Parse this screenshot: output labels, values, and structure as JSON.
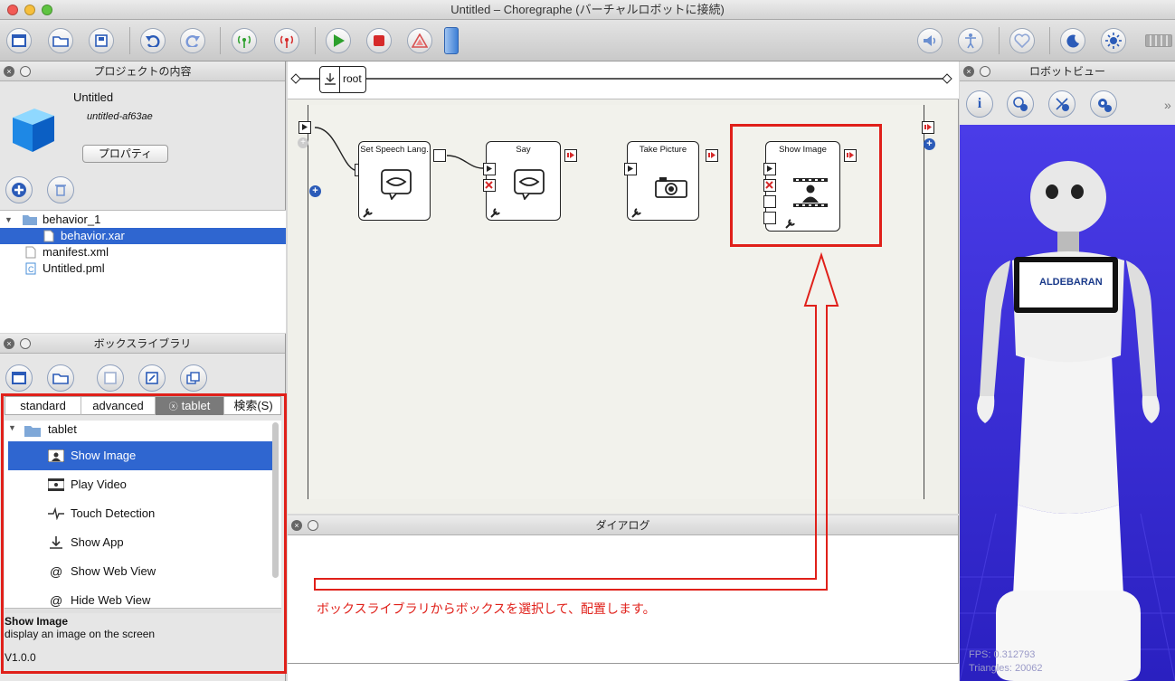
{
  "window": {
    "title": "Untitled – Choregraphe (バーチャルロボットに接続)"
  },
  "colors": {
    "accent": "#2f66d0",
    "annotation": "#e0201a",
    "robot_bg": "#3a2cd8"
  },
  "project_panel": {
    "title": "プロジェクトの内容",
    "project_name": "Untitled",
    "project_id": "untitled-af63ae",
    "properties_button": "プロパティ",
    "tree": [
      {
        "label": "behavior_1"
      },
      {
        "label": "behavior.xar"
      },
      {
        "label": "manifest.xml"
      },
      {
        "label": "Untitled.pml"
      }
    ]
  },
  "library_panel": {
    "title": "ボックスライブラリ",
    "tabs": [
      {
        "label": "standard"
      },
      {
        "label": "advanced"
      },
      {
        "label": "tablet"
      },
      {
        "label": "検索(S)"
      }
    ],
    "folder": "tablet",
    "items": [
      {
        "label": "Show Image",
        "icon": "film-person-icon"
      },
      {
        "label": "Play Video",
        "icon": "film-icon"
      },
      {
        "label": "Touch Detection",
        "icon": "pulse-icon"
      },
      {
        "label": "Show App",
        "icon": "download-icon"
      },
      {
        "label": "Show Web View",
        "icon": "at-icon"
      },
      {
        "label": "Hide Web View",
        "icon": "at-icon"
      }
    ],
    "detail": {
      "name": "Show Image",
      "description": "display an image on the screen",
      "version": "V1.0.0"
    }
  },
  "flow": {
    "root_label": "root",
    "boxes": [
      {
        "title": "Set Speech Lang."
      },
      {
        "title": "Say"
      },
      {
        "title": "Take Picture"
      },
      {
        "title": "Show Image"
      }
    ]
  },
  "dialog_panel": {
    "title": "ダイアログ"
  },
  "annotation": {
    "text": "ボックスライブラリからボックスを選択して、配置します。"
  },
  "robot_panel": {
    "title": "ロボットビュー",
    "logo": "ALDEBARAN",
    "fps": "FPS: 0.312793",
    "triangles": "Triangles: 20062"
  }
}
